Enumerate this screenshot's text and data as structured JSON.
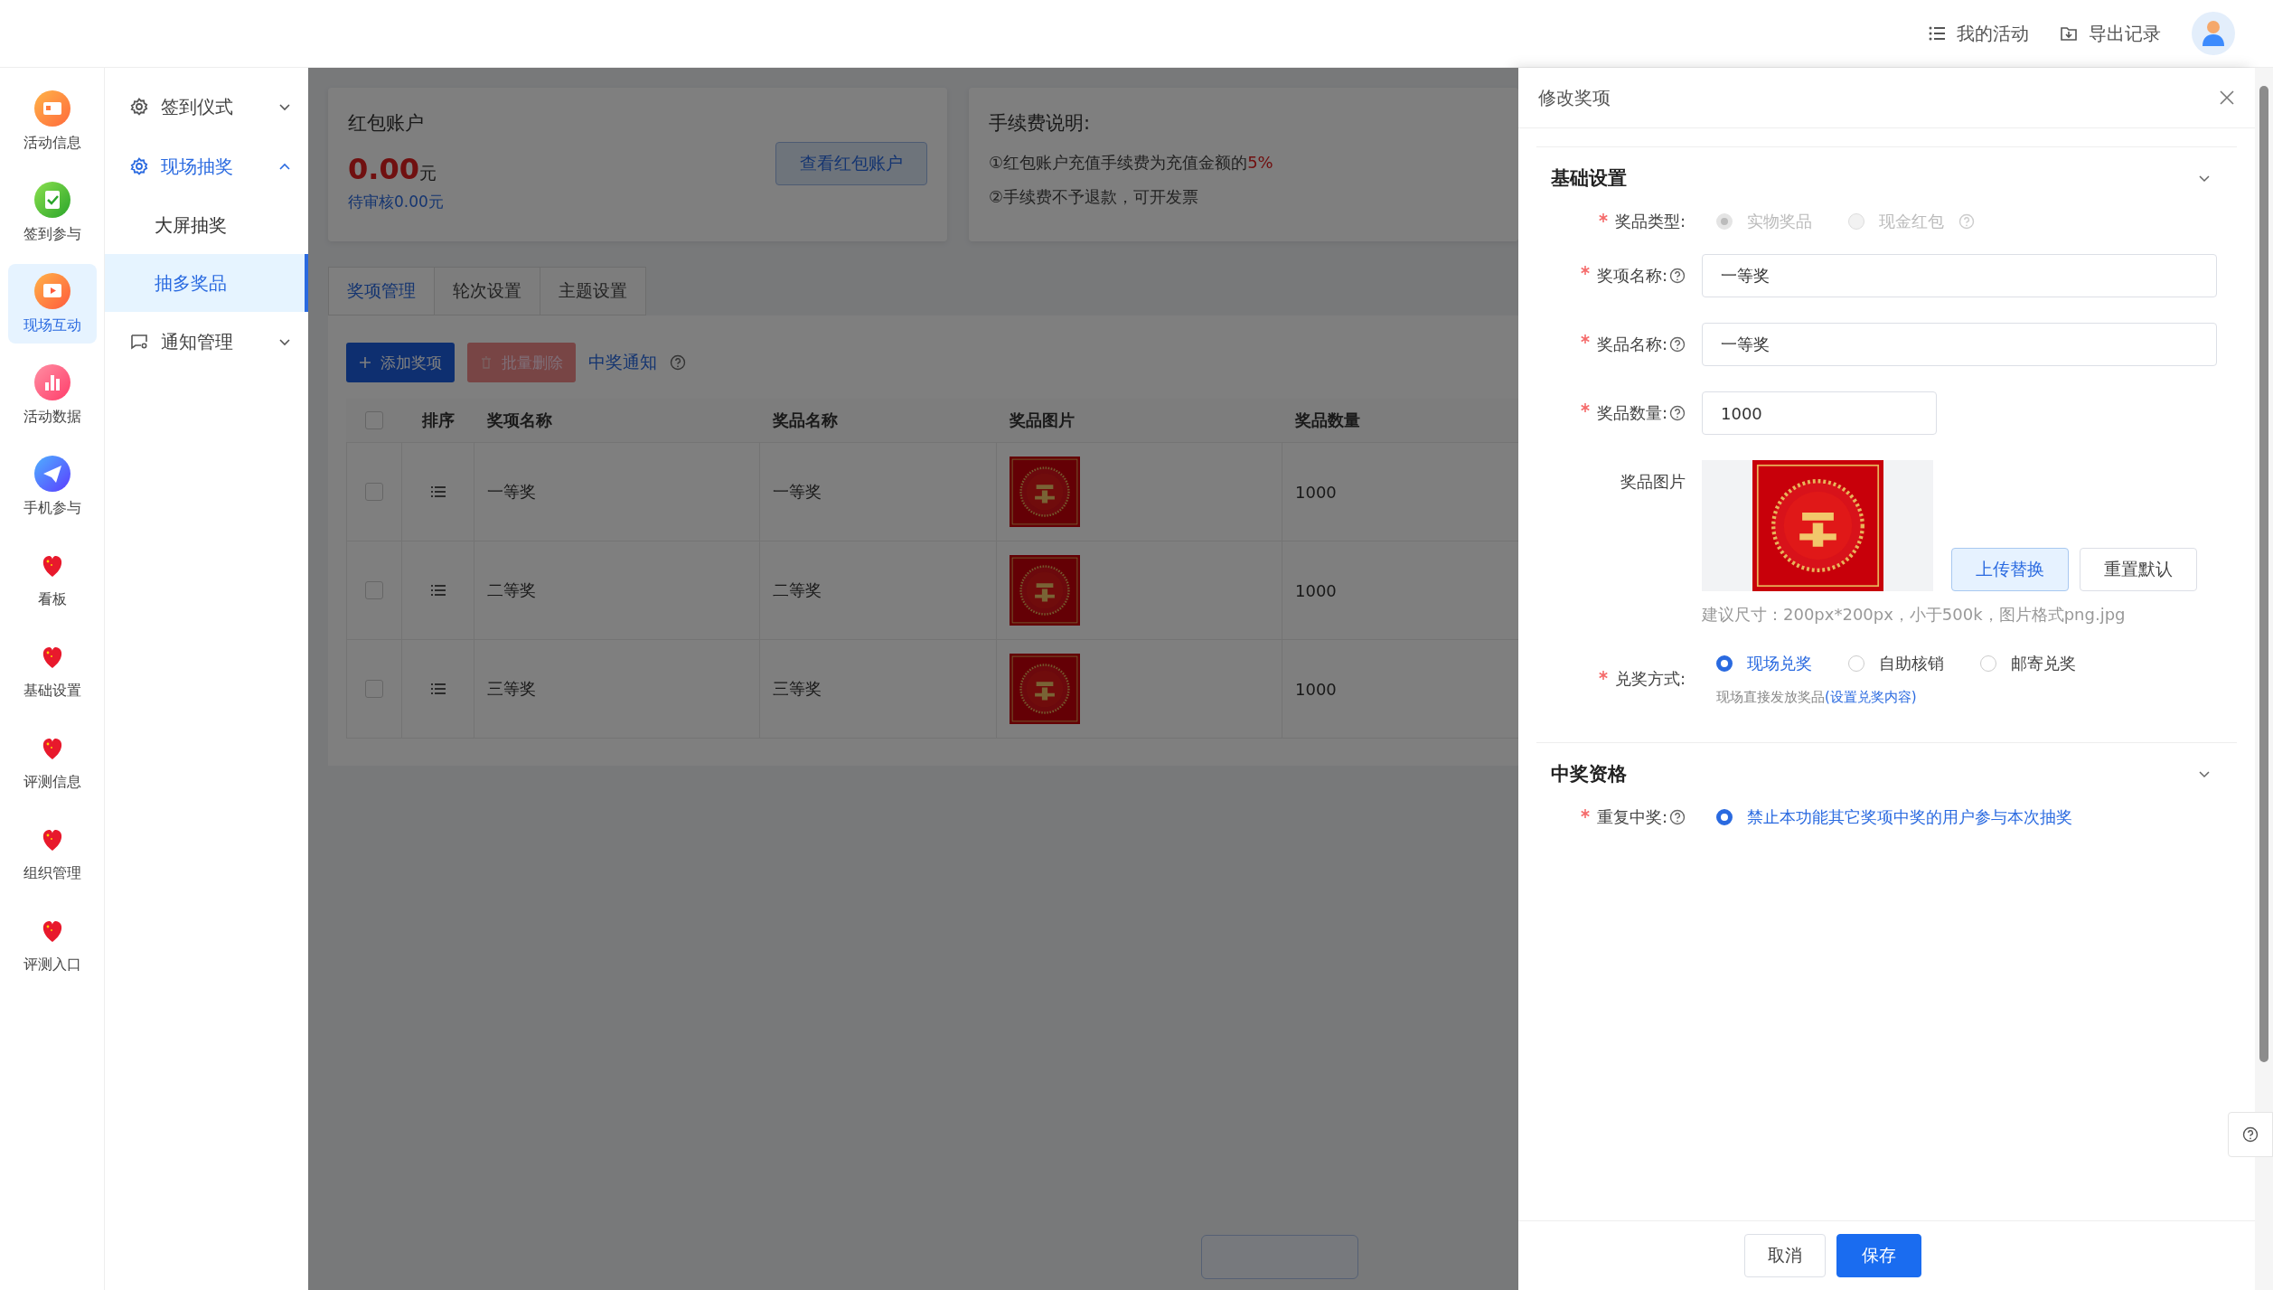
{
  "topbar": {
    "links": [
      {
        "label": "我的活动"
      },
      {
        "label": "导出记录"
      }
    ]
  },
  "rail": [
    {
      "label": "活动信息",
      "selected": false
    },
    {
      "label": "签到参与",
      "selected": false
    },
    {
      "label": "现场互动",
      "selected": true
    },
    {
      "label": "活动数据",
      "selected": false
    },
    {
      "label": "手机参与",
      "selected": false
    },
    {
      "label": "看板",
      "selected": false
    },
    {
      "label": "基础设置",
      "selected": false
    },
    {
      "label": "评测信息",
      "selected": false
    },
    {
      "label": "组织管理",
      "selected": false
    },
    {
      "label": "评测入口",
      "selected": false
    }
  ],
  "menu": [
    {
      "label": "签到仪式",
      "expanded": false
    },
    {
      "label": "现场抽奖",
      "expanded": true,
      "children": [
        {
          "label": "大屏抽奖",
          "selected": false
        },
        {
          "label": "抽多奖品",
          "selected": true
        }
      ]
    },
    {
      "label": "通知管理",
      "expanded": false
    }
  ],
  "account_card": {
    "title": "红包账户",
    "amount": "0.00",
    "unit": "元",
    "pending": "待审核0.00元",
    "button": "查看红包账户"
  },
  "fee_card": {
    "title": "手续费说明:",
    "lines": [
      {
        "text": "①红包账户充值手续费为充值金额的",
        "highlight": "5%"
      },
      {
        "text": "②手续费不予退款，可开发票"
      }
    ]
  },
  "tabs": [
    {
      "label": "奖项管理",
      "selected": true
    },
    {
      "label": "轮次设置",
      "selected": false
    },
    {
      "label": "主题设置",
      "selected": false
    }
  ],
  "toolbar": [
    {
      "label": "添加奖项",
      "kind": "primary"
    },
    {
      "label": "批量删除",
      "kind": "danger"
    },
    {
      "label": "中奖通知",
      "kind": "link"
    }
  ],
  "table": {
    "all_checked": false,
    "columns": [
      "排序",
      "奖项名称",
      "奖品名称",
      "奖品图片",
      "奖品数量"
    ],
    "rows": [
      {
        "checked": false,
        "award": "一等奖",
        "prize": "一等奖",
        "image": {
          "kind": "picture"
        },
        "quantity": "1000"
      },
      {
        "checked": false,
        "award": "二等奖",
        "prize": "二等奖",
        "image": {
          "kind": "picture"
        },
        "quantity": "1000"
      },
      {
        "checked": false,
        "award": "三等奖",
        "prize": "三等奖",
        "image": {
          "kind": "picture"
        },
        "quantity": "1000"
      }
    ]
  },
  "drawer": {
    "title": "修改奖项",
    "sections": [
      {
        "title": "基础设置",
        "expanded": true,
        "fields": [
          {
            "kind": "radio",
            "label": "奖品类型:",
            "required": true,
            "help": false,
            "options": [
              {
                "label": "实物奖品",
                "selected": true,
                "disabled": true,
                "help": false
              },
              {
                "label": "现金红包",
                "selected": false,
                "disabled": true,
                "help": true
              }
            ]
          },
          {
            "kind": "input",
            "label": "奖项名称:",
            "required": true,
            "help": true,
            "value": "一等奖",
            "wide": true
          },
          {
            "kind": "input",
            "label": "奖品名称:",
            "required": true,
            "help": true,
            "value": "一等奖",
            "wide": true
          },
          {
            "kind": "input",
            "label": "奖品数量:",
            "required": true,
            "help": true,
            "value": "1000",
            "wide": false
          },
          {
            "label": "奖品图片",
            "required": false,
            "help": false,
            "image": {
              "kind": "picture"
            },
            "buttons": [
              {
                "label": "上传替换",
                "kind": "primary"
              },
              {
                "label": "重置默认",
                "kind": "default"
              }
            ],
            "hint": "建议尺寸：200px*200px，小于500k，图片格式png.jpg"
          },
          {
            "kind": "radio",
            "label": "兑奖方式:",
            "required": true,
            "help": false,
            "options": [
              {
                "label": "现场兑奖",
                "selected": true,
                "disabled": false,
                "help": false
              },
              {
                "label": "自助核销",
                "selected": false,
                "disabled": false,
                "help": false
              },
              {
                "label": "邮寄兑奖",
                "selected": false,
                "disabled": false,
                "help": false
              }
            ],
            "note": "现场直接发放奖品",
            "note_link": "(设置兑奖内容)"
          }
        ]
      },
      {
        "title": "中奖资格",
        "expanded": true,
        "fields": [
          {
            "kind": "radio",
            "label": "重复中奖:",
            "required": true,
            "help": true,
            "options": [
              {
                "label": "禁止本功能其它奖项中奖的用户参与本次抽奖",
                "selected": true,
                "disabled": false,
                "help": false
              }
            ]
          }
        ]
      }
    ],
    "footer": [
      {
        "label": "取消",
        "kind": "default"
      },
      {
        "label": "保存",
        "kind": "primary"
      }
    ]
  }
}
